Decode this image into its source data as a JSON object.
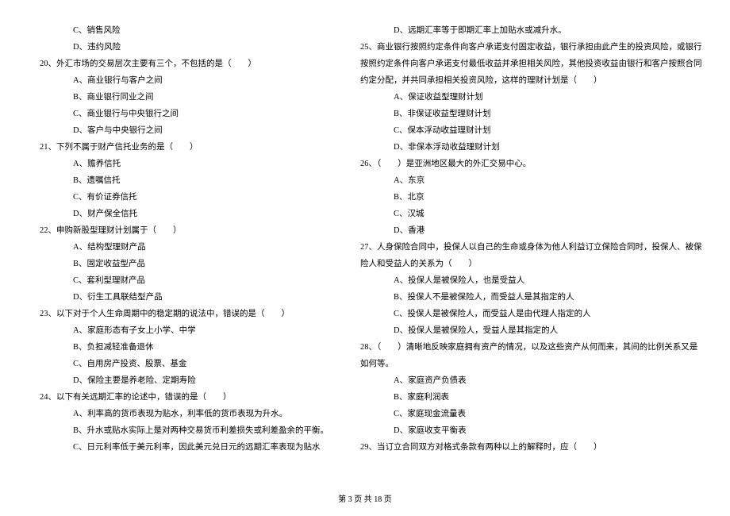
{
  "leftColumn": {
    "lines": [
      {
        "cls": "indent-1",
        "text": "C、销售风险"
      },
      {
        "cls": "indent-1",
        "text": "D、违约风险"
      },
      {
        "cls": "question",
        "text": "20、外汇市场的交易层次主要有三个，不包括的是（　　）"
      },
      {
        "cls": "indent-1",
        "text": "A、商业银行与客户之间"
      },
      {
        "cls": "indent-1",
        "text": "B、商业银行同业之间"
      },
      {
        "cls": "indent-1",
        "text": "C、商业银行与中央银行之间"
      },
      {
        "cls": "indent-1",
        "text": "D、客户与中央银行之间"
      },
      {
        "cls": "question",
        "text": "21、下列不属于财产信托业务的是（　　）"
      },
      {
        "cls": "indent-1",
        "text": "A、赡养信托"
      },
      {
        "cls": "indent-1",
        "text": "B、遗嘱信托"
      },
      {
        "cls": "indent-1",
        "text": "C、有价证券信托"
      },
      {
        "cls": "indent-1",
        "text": "D、财产保全信托"
      },
      {
        "cls": "question",
        "text": "22、申购新股型理财计划属于（　　）"
      },
      {
        "cls": "indent-1",
        "text": "A、结构型理财产品"
      },
      {
        "cls": "indent-1",
        "text": "B、固定收益型产品"
      },
      {
        "cls": "indent-1",
        "text": "C、套利型理财产品"
      },
      {
        "cls": "indent-1",
        "text": "D、衍生工具联结型产品"
      },
      {
        "cls": "question",
        "text": "23、以下对于个人生命周期中的稳定期的说法中，错误的是（　　）"
      },
      {
        "cls": "indent-1",
        "text": "A、家庭形态有子女上小学、中学"
      },
      {
        "cls": "indent-1",
        "text": "B、负担减轻准备退休"
      },
      {
        "cls": "indent-1",
        "text": "C、自用房产投资、股票、基金"
      },
      {
        "cls": "indent-1",
        "text": "D、保险主要是养老险、定期寿险"
      },
      {
        "cls": "question",
        "text": "24、以下有关远期汇率的论述中，错误的是（　　）"
      },
      {
        "cls": "indent-1",
        "text": "A、利率高的货币表现为贴水，利率低的货币表现为升水。"
      },
      {
        "cls": "indent-1",
        "text": "B、升水或贴水实际上是对两种交易货币利差损失或利差盈余的平衡。"
      },
      {
        "cls": "indent-1",
        "text": "C、日元利率低于美元利率，因此美元兑日元的远期汇率表现为贴水"
      }
    ]
  },
  "rightColumn": {
    "lines": [
      {
        "cls": "indent-1",
        "text": "D、远期汇率等于即期汇率上加贴水或减升水。"
      },
      {
        "cls": "question",
        "text": "25、商业银行按照约定条件向客户承诺支付固定收益，银行承担由此产生的投资风险，或银行"
      },
      {
        "cls": "continuation",
        "text": "按照约定条件向客户承诺支付最低收益并承担相关风险，其他投资收益由银行和客户按照合同"
      },
      {
        "cls": "continuation",
        "text": "约定分配，并共同承担相关投资风险，这样的理财计划是（　　）"
      },
      {
        "cls": "indent-1",
        "text": "A、保证收益型理财计划"
      },
      {
        "cls": "indent-1",
        "text": "B、非保证收益型理财计划"
      },
      {
        "cls": "indent-1",
        "text": "C、保本浮动收益理财计划"
      },
      {
        "cls": "indent-1",
        "text": "D、非保本浮动收益理财计划"
      },
      {
        "cls": "question",
        "text": "26、（　　）是亚洲地区最大的外汇交易中心。"
      },
      {
        "cls": "indent-1",
        "text": "A、东京"
      },
      {
        "cls": "indent-1",
        "text": "B、北京"
      },
      {
        "cls": "indent-1",
        "text": "C、汉城"
      },
      {
        "cls": "indent-1",
        "text": "D、香港"
      },
      {
        "cls": "question",
        "text": "27、人身保险合同中，投保人以自己的生命或身体为他人利益订立保险合同时，投保人、被保"
      },
      {
        "cls": "continuation",
        "text": "险人和受益人的关系为（　　）"
      },
      {
        "cls": "indent-1",
        "text": "A、投保人是被保险人，也是受益人"
      },
      {
        "cls": "indent-1",
        "text": "B、投保人不是被保险人，而受益人是其指定的人"
      },
      {
        "cls": "indent-1",
        "text": "C、投保人是被保险人，而受益人是由代理人指定的人"
      },
      {
        "cls": "indent-1",
        "text": "D、投保人是被保险人，受益人是其指定的人"
      },
      {
        "cls": "question",
        "text": "28、（　　）清晰地反映家庭拥有资产的情况，以及这些资产从何而来，其间的比例关系又是"
      },
      {
        "cls": "continuation",
        "text": "如何等。"
      },
      {
        "cls": "indent-1",
        "text": "A、家庭资产负债表"
      },
      {
        "cls": "indent-1",
        "text": "B、家庭利润表"
      },
      {
        "cls": "indent-1",
        "text": "C、家庭现金流量表"
      },
      {
        "cls": "indent-1",
        "text": "D、家庭收支平衡表"
      },
      {
        "cls": "question",
        "text": "29、当订立合同双方对格式条款有两种以上的解释时，应（　　）"
      }
    ]
  },
  "footer": "第 3 页 共 18 页"
}
